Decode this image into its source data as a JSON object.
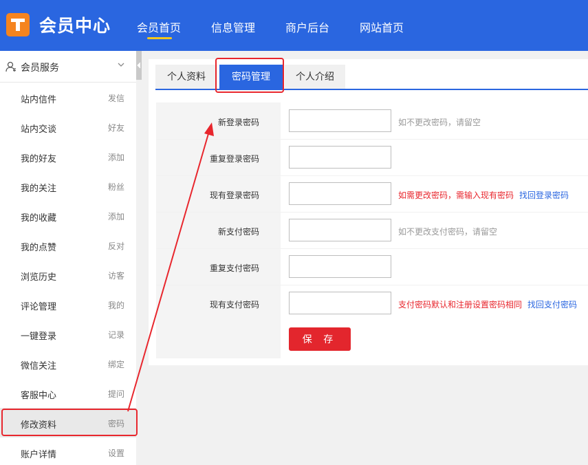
{
  "header": {
    "logo_icon": "t-logo-icon",
    "title": "会员中心",
    "nav": [
      "会员首页",
      "信息管理",
      "商户后台",
      "网站首页"
    ],
    "active_nav": "会员首页",
    "colors": {
      "bar": "#2a66e0",
      "logo": "#f5841f",
      "underline": "#f7c81d"
    }
  },
  "sidebar": {
    "section_title": "会员服务",
    "items": [
      {
        "label": "站内信件",
        "sub": "发信"
      },
      {
        "label": "站内交谈",
        "sub": "好友"
      },
      {
        "label": "我的好友",
        "sub": "添加"
      },
      {
        "label": "我的关注",
        "sub": "粉丝"
      },
      {
        "label": "我的收藏",
        "sub": "添加"
      },
      {
        "label": "我的点赞",
        "sub": "反对"
      },
      {
        "label": "浏览历史",
        "sub": "访客"
      },
      {
        "label": "评论管理",
        "sub": "我的"
      },
      {
        "label": "一键登录",
        "sub": "记录"
      },
      {
        "label": "微信关注",
        "sub": "绑定"
      },
      {
        "label": "客服中心",
        "sub": "提问"
      },
      {
        "label": "修改资料",
        "sub": "密码"
      },
      {
        "label": "账户详情",
        "sub": "设置"
      }
    ],
    "active_item": "修改资料"
  },
  "tabs": [
    {
      "label": "个人资料"
    },
    {
      "label": "密码管理"
    },
    {
      "label": "个人介绍"
    }
  ],
  "active_tab": "密码管理",
  "form": {
    "fields": [
      {
        "label": "新登录密码",
        "value": "",
        "hint": "如不更改密码，请留空",
        "hint_red": "",
        "link": ""
      },
      {
        "label": "重复登录密码",
        "value": "",
        "hint": "",
        "hint_red": "",
        "link": ""
      },
      {
        "label": "现有登录密码",
        "value": "",
        "hint": "",
        "hint_red": "如需更改密码，需输入现有密码",
        "link": "找回登录密码"
      },
      {
        "label": "新支付密码",
        "value": "",
        "hint": "如不更改支付密码，请留空",
        "hint_red": "",
        "link": ""
      },
      {
        "label": "重复支付密码",
        "value": "",
        "hint": "",
        "hint_red": "",
        "link": ""
      },
      {
        "label": "现有支付密码",
        "value": "",
        "hint": "",
        "hint_red": "支付密码默认和注册设置密码相同",
        "link": "找回支付密码"
      }
    ],
    "save_label": "保 存"
  },
  "colors": {
    "accent": "#2a66e0",
    "danger": "#e8262d",
    "save": "#e3262d"
  }
}
